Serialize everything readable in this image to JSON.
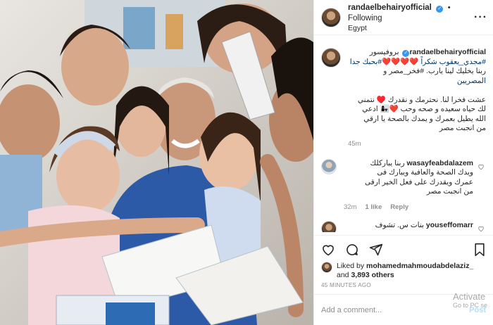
{
  "post": {
    "username": "randaelbehairyofficial",
    "follow_status": "Following",
    "separator": "•",
    "location": "Egypt",
    "more_icon": "more-horizontal-icon"
  },
  "caption": {
    "username": "randaelbehairyofficial",
    "line1": "بروفيسور",
    "line2": "#مجدي_يعقوب شكراً ❤️❤️❤️❤️",
    "line2b": "#بحبك جدا",
    "line3": "ربنا يخليك لينا يارب. #فخر_مصر و",
    "line4": "المصريين",
    "line5": "عشت فخرا لنا. نحترمك و نقدرك ♥️ نتمني",
    "line6": "لك حياه سعيده و صحه وحب ❤️👩‍👧 ادعي",
    "line7": "الله يطيل بعمرك و يمدك بالصحة يا ارقي",
    "line8": "من انجبت مصر",
    "time": "45m"
  },
  "comments": [
    {
      "username": "wasayfeabdalazem",
      "lines": [
        "ربنا يباركلك",
        "ويدك الصحة والعافية ويبارك فى",
        "عمرك ويقدرك على فعل الخير ارقى",
        "من انجبت مصر"
      ],
      "time": "32m",
      "likes": "1 like",
      "reply": "Reply"
    },
    {
      "username": "youseffomarr",
      "lines": [
        "بنات س. تشوف"
      ]
    }
  ],
  "actions": {
    "like_icon": "heart-icon",
    "comment_icon": "comment-icon",
    "share_icon": "send-icon",
    "save_icon": "bookmark-icon"
  },
  "likes": {
    "prefix": "Liked by",
    "user": "mohamedmahmoudabdelaziz_",
    "joiner": "and",
    "others": "3,893 others"
  },
  "timestamp": "45 MINUTES AGO",
  "add_comment": {
    "placeholder": "Add a comment...",
    "post_label": "Post"
  },
  "watermark": {
    "line1": "Activate",
    "line2": "Go to PC se"
  },
  "colors": {
    "link": "#00376b",
    "verified": "#3897f0",
    "muted": "#8e8e8e",
    "post_button": "#b2dffc"
  }
}
